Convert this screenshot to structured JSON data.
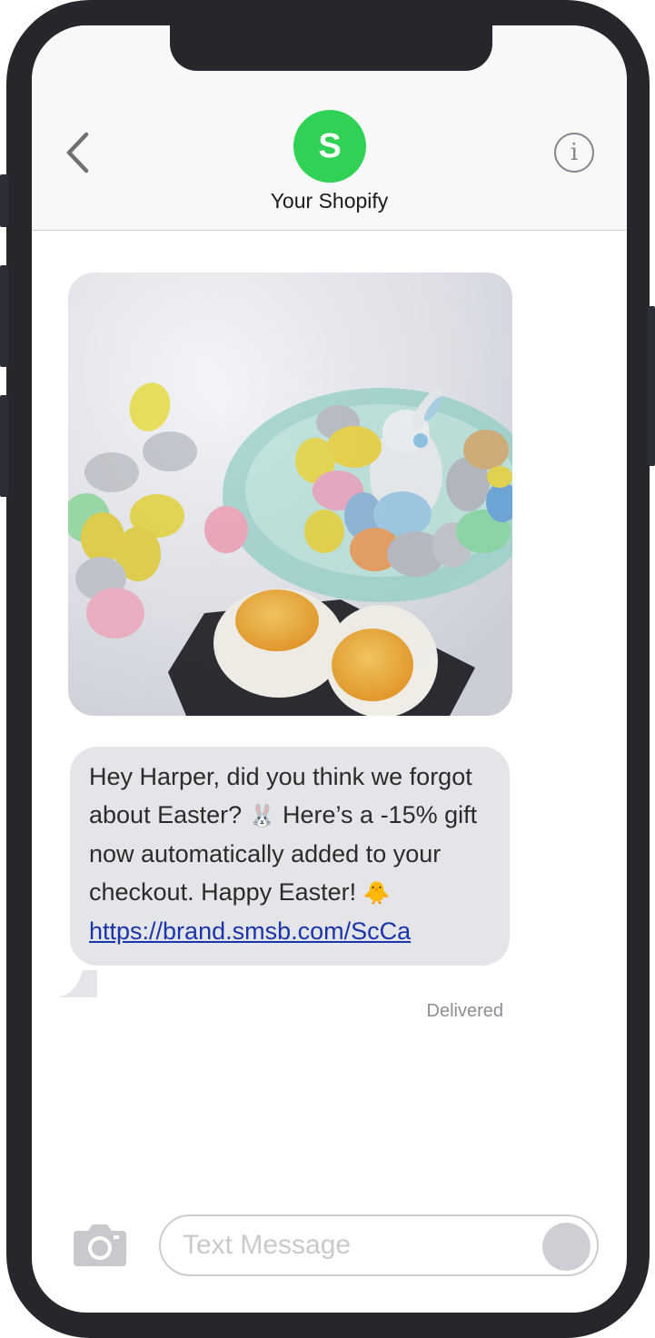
{
  "header": {
    "avatar_letter": "S",
    "contact_name": "Your Shopify"
  },
  "message": {
    "text_before_bunny": "Hey Harper, did you think we forgot about Easter? ",
    "bunny_emoji": "🐰",
    "text_middle": " Here’s a -15% gift now automatically added to your checkout. Happy Easter! ",
    "chick_emoji": "🐥",
    "link": "https://brand.smsb.com/ScCa",
    "status": "Delivered"
  },
  "composer": {
    "placeholder": "Text Message"
  },
  "icons": {
    "back": "chevron-left-icon",
    "info": "info-icon",
    "camera": "camera-icon"
  },
  "colors": {
    "avatar": "#2fd254",
    "bubble": "#e3e5e9",
    "link": "#1b34a8",
    "frame": "#25272c"
  }
}
